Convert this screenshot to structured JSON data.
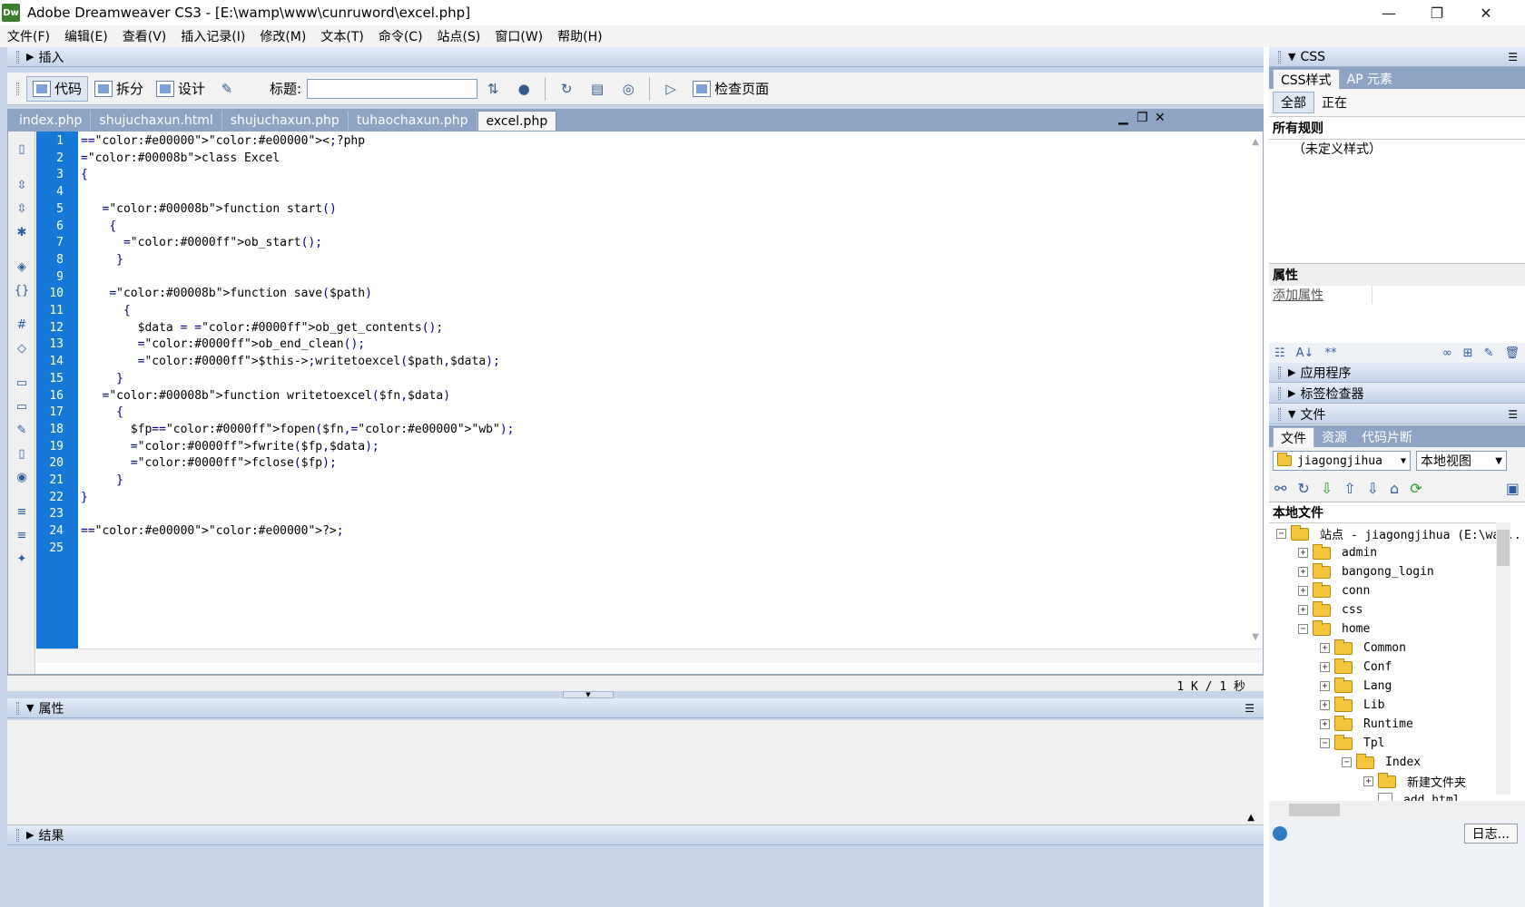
{
  "titlebar": {
    "app_icon": "Dw",
    "title": "Adobe Dreamweaver CS3 - [E:\\wamp\\www\\cunruword\\excel.php]",
    "minimize": "—",
    "restore": "❐",
    "close": "✕"
  },
  "menu": [
    "文件(F)",
    "编辑(E)",
    "查看(V)",
    "插入记录(I)",
    "修改(M)",
    "文本(T)",
    "命令(C)",
    "站点(S)",
    "窗口(W)",
    "帮助(H)"
  ],
  "insert_panel": {
    "label": "插入"
  },
  "toolbar": {
    "code": "代码",
    "split": "拆分",
    "design": "设计",
    "title_label": "标题:",
    "title_value": "",
    "check_page": "检查页面"
  },
  "doc_tabs": [
    "index.php",
    "shujuchaxun.html",
    "shujuchaxun.php",
    "tuhaochaxun.php",
    "excel.php"
  ],
  "active_tab": "excel.php",
  "code_lines": [
    "<?php",
    "class Excel",
    "{",
    "",
    "   function start()",
    "    {",
    "      ob_start();",
    "     }",
    "",
    "    function save($path)",
    "      {",
    "        $data = ob_get_contents();",
    "        ob_end_clean();",
    "        $this->writetoexcel($path,$data);",
    "     }",
    "   function writetoexcel($fn,$data)",
    "     {",
    "       $fp=fopen($fn,\"wb\");",
    "       fwrite($fp,$data);",
    "       fclose($fp);",
    "     }",
    "}",
    "",
    "?>",
    ""
  ],
  "line_numbers": [
    "1",
    "2",
    "3",
    "4",
    "5",
    "6",
    "7",
    "8",
    "9",
    "10",
    "11",
    "12",
    "13",
    "14",
    "15",
    "16",
    "17",
    "18",
    "19",
    "20",
    "21",
    "22",
    "23",
    "24",
    "25"
  ],
  "status": {
    "size": "1 K / 1 秒"
  },
  "properties_panel": {
    "label": "属性"
  },
  "results_panel": {
    "label": "结果"
  },
  "right": {
    "css_header": "CSS",
    "css_tabs": [
      "CSS样式",
      "AP 元素"
    ],
    "mode_buttons": [
      "全部",
      "正在"
    ],
    "all_rules": "所有规则",
    "undefined_style": "（未定义样式）",
    "properties": "属性",
    "add_property": "添加属性",
    "app_panel": "应用程序",
    "tag_inspector": "标签检查器",
    "files_header": "文件",
    "files_tabs": [
      "文件",
      "资源",
      "代码片断"
    ],
    "site_select": "jiagongjihua",
    "view_select": "本地视图",
    "local_files": "本地文件",
    "tree": [
      {
        "label": "站点 - jiagongjihua (E:\\wa...",
        "level": 0,
        "pm": "−",
        "type": "folder"
      },
      {
        "label": "admin",
        "level": 1,
        "pm": "+",
        "type": "folder"
      },
      {
        "label": "bangong_login",
        "level": 1,
        "pm": "+",
        "type": "folder"
      },
      {
        "label": "conn",
        "level": 1,
        "pm": "+",
        "type": "folder"
      },
      {
        "label": "css",
        "level": 1,
        "pm": "+",
        "type": "folder"
      },
      {
        "label": "home",
        "level": 1,
        "pm": "−",
        "type": "folder"
      },
      {
        "label": "Common",
        "level": 2,
        "pm": "+",
        "type": "folder"
      },
      {
        "label": "Conf",
        "level": 2,
        "pm": "+",
        "type": "folder"
      },
      {
        "label": "Lang",
        "level": 2,
        "pm": "+",
        "type": "folder"
      },
      {
        "label": "Lib",
        "level": 2,
        "pm": "+",
        "type": "folder"
      },
      {
        "label": "Runtime",
        "level": 2,
        "pm": "+",
        "type": "folder"
      },
      {
        "label": "Tpl",
        "level": 2,
        "pm": "−",
        "type": "folder"
      },
      {
        "label": "Index",
        "level": 3,
        "pm": "−",
        "type": "folder"
      },
      {
        "label": "新建文件夹",
        "level": 4,
        "pm": "+",
        "type": "folder"
      },
      {
        "label": "add.html",
        "level": 4,
        "pm": "",
        "type": "file"
      }
    ],
    "log_button": "日志..."
  }
}
